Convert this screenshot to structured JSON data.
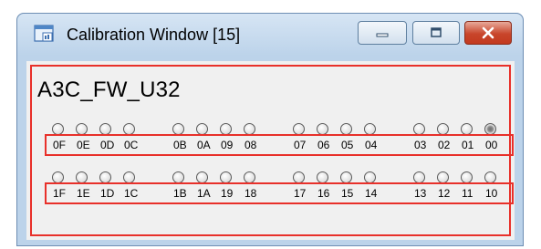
{
  "window": {
    "title": "Calibration Window [15]"
  },
  "device": {
    "name": "A3C_FW_U32"
  },
  "registers": {
    "row1": {
      "labels": [
        "0F",
        "0E",
        "0D",
        "0C",
        "0B",
        "0A",
        "09",
        "08",
        "07",
        "06",
        "05",
        "04",
        "03",
        "02",
        "01",
        "00"
      ],
      "states": [
        false,
        false,
        false,
        false,
        false,
        false,
        false,
        false,
        false,
        false,
        false,
        false,
        false,
        false,
        false,
        true
      ]
    },
    "row2": {
      "labels": [
        "1F",
        "1E",
        "1D",
        "1C",
        "1B",
        "1A",
        "19",
        "18",
        "17",
        "16",
        "15",
        "14",
        "13",
        "12",
        "11",
        "10"
      ],
      "states": [
        false,
        false,
        false,
        false,
        false,
        false,
        false,
        false,
        false,
        false,
        false,
        false,
        false,
        false,
        false,
        false
      ]
    }
  },
  "icons": {
    "app": "calibration-window-icon",
    "minimize": "minimize-icon",
    "maximize": "maximize-icon",
    "close": "close-icon"
  },
  "colors": {
    "highlight_border": "#e8302a",
    "close_button": "#c8452b"
  }
}
